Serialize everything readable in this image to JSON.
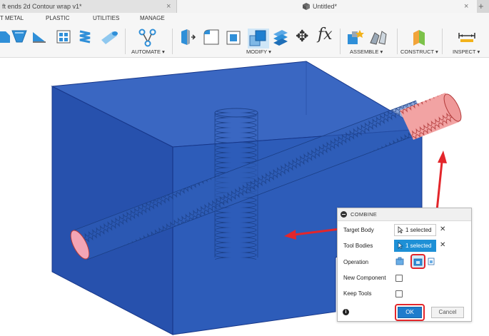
{
  "tabs": {
    "left_title": "ft ends 2d Contour wrap v1*",
    "right_title": "Untitled*",
    "close_glyph": "×",
    "add_glyph": "+"
  },
  "ribbon": {
    "tabs": [
      "T METAL",
      "PLASTIC",
      "UTILITIES",
      "MANAGE"
    ],
    "groups": {
      "automate": "AUTOMATE ▾",
      "modify": "MODIFY ▾",
      "assemble": "ASSEMBLE ▾",
      "construct": "CONSTRUCT ▾",
      "inspect": "INSPECT ▾"
    },
    "fx_glyph": "fx",
    "move_glyph": "✥",
    "icons": [
      "flange-icon",
      "bend-icon",
      "unfold-icon",
      "grid-icon",
      "spring-icon",
      "pipe-icon",
      "automate-icon",
      "press-pull-icon",
      "fillet-icon",
      "shell-icon",
      "combine-icon",
      "split-face-icon",
      "move-icon",
      "parameters-icon",
      "new-component-icon",
      "joint-icon",
      "plane-icon",
      "measure-icon"
    ]
  },
  "dialog": {
    "title": "COMBINE",
    "rows": {
      "target_body": "Target Body",
      "tool_bodies": "Tool Bodies",
      "operation": "Operation",
      "new_component": "New Component",
      "keep_tools": "Keep Tools"
    },
    "target_value": "1 selected",
    "tool_value": "1 selected",
    "clear_glyph": "✕",
    "info_glyph": "i",
    "ok_label": "OK",
    "cancel_label": "Cancel"
  },
  "colors": {
    "body_blue": "#2f5fb8",
    "selection_blue": "#1e90d6",
    "highlight_red": "#e3262b",
    "tool_pink": "#f08c8c"
  }
}
